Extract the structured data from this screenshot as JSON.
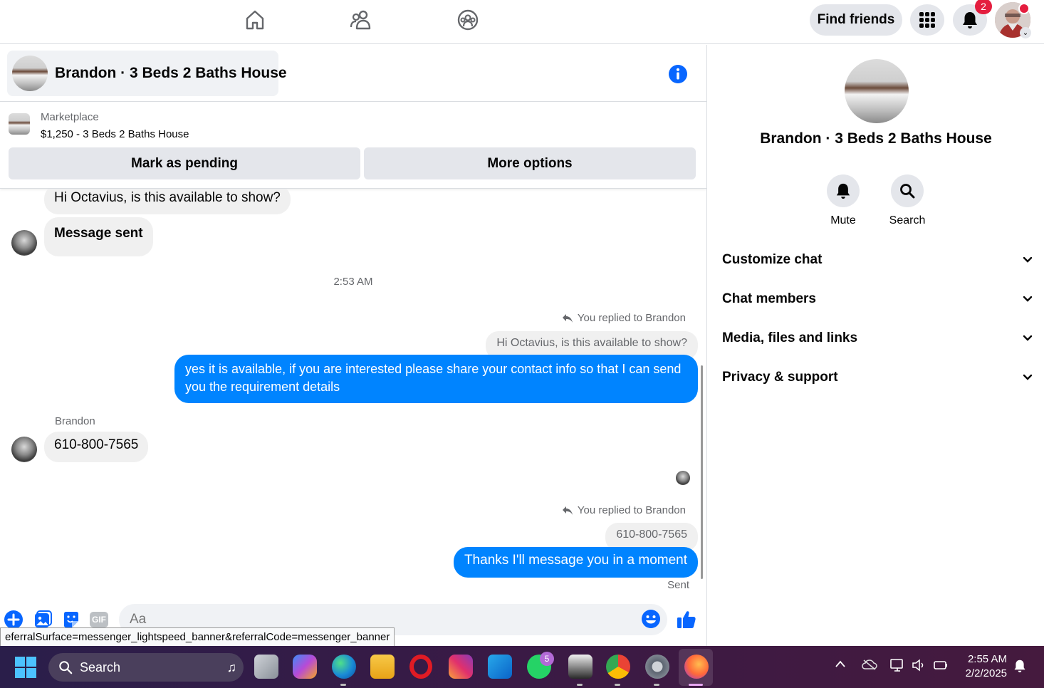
{
  "header": {
    "find_friends": "Find friends",
    "notification_count": "2",
    "nav_icons": [
      "home-icon",
      "friends-icon",
      "groups-icon"
    ]
  },
  "chat": {
    "title": "Brandon · 3 Beds 2 Baths House",
    "marketplace_label": "Marketplace",
    "listing": "$1,250 - 3 Beds 2 Baths House",
    "mark_pending": "Mark as pending",
    "more_options": "More options"
  },
  "messages": {
    "m1": "Hi Octavius, is this available to show?",
    "m2": "Message sent",
    "timestamp": "2:53 AM",
    "reply_note_1": "You replied to Brandon",
    "quote_1": "Hi Octavius, is this available to show?",
    "out_1": "yes it is available, if you are interested please share your contact info so that I can send you the requirement details",
    "sender_name": "Brandon",
    "in_phone": "610-800-7565",
    "reply_note_2": "You replied to Brandon",
    "quote_2": "610-800-7565",
    "out_2": "Thanks I'll message you in a moment",
    "sent_label": "Sent"
  },
  "composer": {
    "placeholder": "Aa",
    "gif": "GIF",
    "tooltip": "eferralSurface=messenger_lightspeed_banner&referralCode=messenger_banner"
  },
  "panel": {
    "title": "Brandon · 3 Beds 2 Baths House",
    "mute": "Mute",
    "search": "Search",
    "sections": [
      "Customize chat",
      "Chat members",
      "Media, files and links",
      "Privacy & support"
    ]
  },
  "taskbar": {
    "search": "Search",
    "whatsapp_badge": "5",
    "time": "2:55 AM",
    "date": "2/2/2025"
  },
  "colors": {
    "accent": "#0084ff",
    "fb_blue": "#0866ff",
    "badge_red": "#e41e3f"
  }
}
